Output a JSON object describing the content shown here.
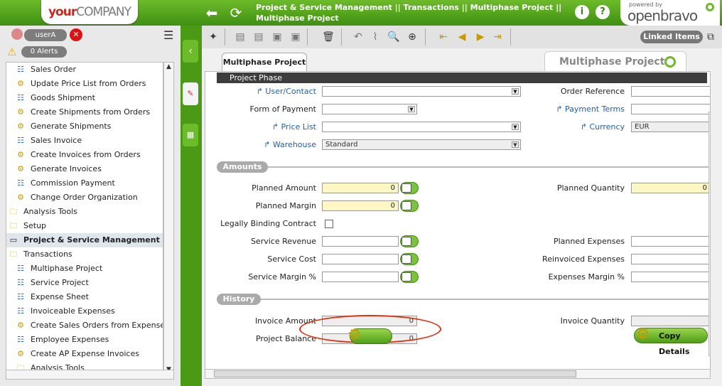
{
  "header": {
    "logo_your": "your",
    "logo_company": "COMPANY",
    "breadcrumb": "Project & Service Management || Transactions || Multiphase Project || Multiphase Project",
    "info_label": "i",
    "help_label": "?",
    "powered_by": "powered by",
    "brand": "openbravo"
  },
  "user": {
    "name": "userA",
    "alerts": "0 Alerts"
  },
  "tree": {
    "items": [
      {
        "label": "Sales Order",
        "icon": "doc"
      },
      {
        "label": "Update Price List from Orders",
        "icon": "gear"
      },
      {
        "label": "Goods Shipment",
        "icon": "doc"
      },
      {
        "label": "Create Shipments from Orders",
        "icon": "gear"
      },
      {
        "label": "Generate Shipments",
        "icon": "gear"
      },
      {
        "label": "Sales Invoice",
        "icon": "doc"
      },
      {
        "label": "Create Invoices from Orders",
        "icon": "gear"
      },
      {
        "label": "Generate Invoices",
        "icon": "gear"
      },
      {
        "label": "Commission Payment",
        "icon": "doc"
      },
      {
        "label": "Change Order Organization",
        "icon": "gear"
      },
      {
        "label": "Analysis Tools",
        "icon": "folder",
        "top": true
      },
      {
        "label": "Setup",
        "icon": "folder",
        "top": true
      },
      {
        "label": "Project & Service Management",
        "icon": "section",
        "section": true
      },
      {
        "label": "Transactions",
        "icon": "folder",
        "top": true
      },
      {
        "label": "Multiphase Project",
        "icon": "doc"
      },
      {
        "label": "Service Project",
        "icon": "doc"
      },
      {
        "label": "Expense Sheet",
        "icon": "doc"
      },
      {
        "label": "Invoiceable Expenses",
        "icon": "doc"
      },
      {
        "label": "Create Sales Orders from Expenses",
        "icon": "gear"
      },
      {
        "label": "Employee Expenses",
        "icon": "doc"
      },
      {
        "label": "Create AP Expense Invoices",
        "icon": "gear"
      },
      {
        "label": "Analysis Tools",
        "icon": "folder"
      }
    ]
  },
  "toolbar": {
    "linked_items": "Linked Items"
  },
  "tabs": {
    "active": "Multiphase Project",
    "window_title": "Multiphase Project"
  },
  "form": {
    "phase_bar": "Project Phase",
    "user_contact": "User/Contact",
    "form_of_payment": "Form of Payment",
    "price_list": "Price List",
    "warehouse": "Warehouse",
    "warehouse_value": "Standard",
    "order_reference": "Order Reference",
    "payment_terms": "Payment Terms",
    "currency": "Currency",
    "currency_value": "EUR",
    "amounts": "Amounts",
    "planned_amount": "Planned Amount",
    "planned_amount_value": "0",
    "planned_margin": "Planned Margin",
    "planned_margin_value": "0",
    "legally_binding": "Legally Binding Contract",
    "service_revenue": "Service Revenue",
    "service_cost": "Service Cost",
    "service_margin": "Service Margin %",
    "planned_quantity": "Planned Quantity",
    "planned_quantity_value": "0",
    "planned_expenses": "Planned Expenses",
    "reinvoiced_expenses": "Reinvoiced Expenses",
    "expenses_margin": "Expenses Margin %",
    "history": "History",
    "invoice_amount": "Invoice Amount",
    "invoice_amount_value": "0",
    "project_balance": "Project Balance",
    "project_balance_value": "0",
    "invoice_quantity": "Invoice Quantity",
    "copy_details": "Copy Details"
  }
}
